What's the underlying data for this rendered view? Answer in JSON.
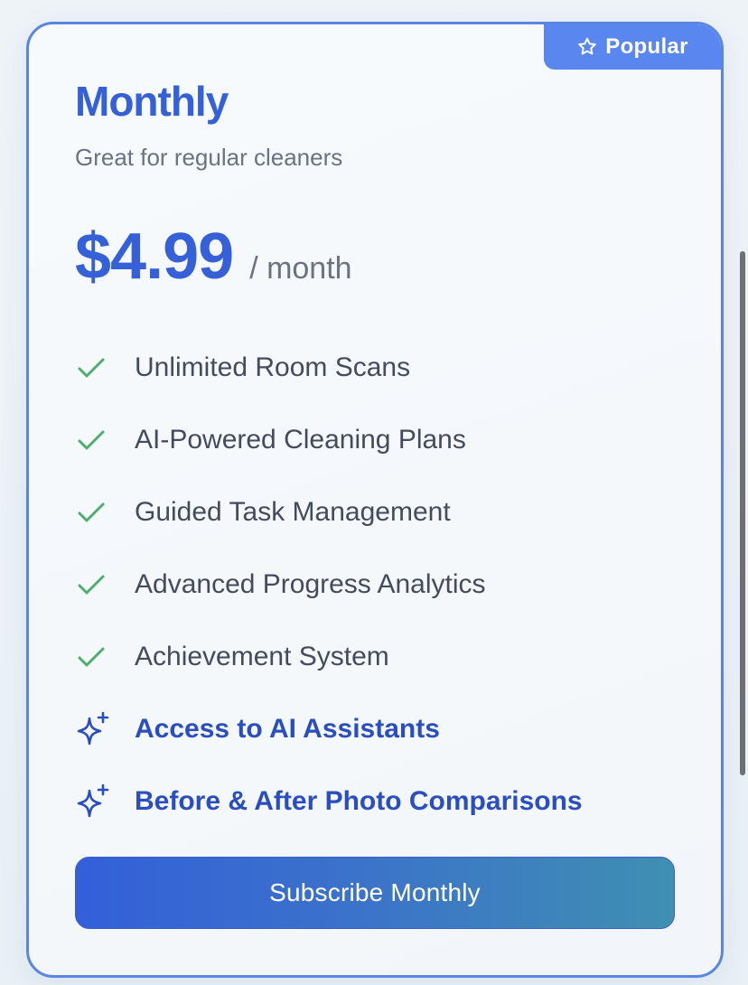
{
  "card": {
    "badge": {
      "label": "Popular",
      "icon": "star-outline-icon"
    },
    "plan_name": "Monthly",
    "description": "Great for regular cleaners",
    "price": "$4.99",
    "period": "/ month",
    "features": [
      {
        "label": "Unlimited Room Scans",
        "icon": "check-icon",
        "premium": false
      },
      {
        "label": "AI-Powered Cleaning Plans",
        "icon": "check-icon",
        "premium": false
      },
      {
        "label": "Guided Task Management",
        "icon": "check-icon",
        "premium": false
      },
      {
        "label": "Advanced Progress Analytics",
        "icon": "check-icon",
        "premium": false
      },
      {
        "label": "Achievement System",
        "icon": "check-icon",
        "premium": false
      },
      {
        "label": "Access to AI Assistants",
        "icon": "sparkles-icon",
        "premium": true
      },
      {
        "label": "Before & After Photo Comparisons",
        "icon": "sparkles-icon",
        "premium": true
      }
    ],
    "cta_label": "Subscribe Monthly"
  },
  "colors": {
    "accent": "#3560d8",
    "border": "#5b86df",
    "badge_bg": "#5a86ef",
    "check": "#4caf6e",
    "premium_text": "#2a4ec0",
    "muted_text": "#6b7280",
    "button_gradient_start": "#335fd9",
    "button_gradient_end": "#3f8fb2"
  }
}
